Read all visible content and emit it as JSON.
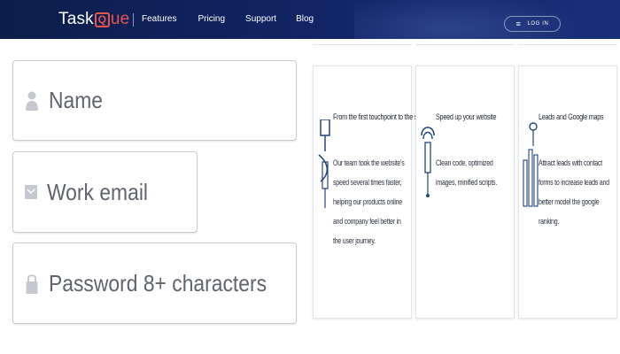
{
  "brand": {
    "logo_prefix": "Task",
    "logo_mark": "Q",
    "logo_suffix": "ue",
    "accent": "#e2564f"
  },
  "nav": {
    "items": [
      "Features",
      "Pricing",
      "Support",
      "Blog"
    ]
  },
  "header": {
    "login_label": "LOG IN",
    "login_icon": "login-icon",
    "background": "#13266a"
  },
  "form": {
    "name_placeholder": "Name",
    "email_placeholder": "Work email",
    "password_placeholder": "Password 8+ characters"
  },
  "cards": [
    {
      "icon": "building-icon",
      "title": "From the first touchpoint to the sale",
      "text": "Our team took the website's speed several times faster, helping our products online and company feel better in the user journey."
    },
    {
      "icon": "speed-icon",
      "title": "Speed up your website",
      "text": "Clean code, optimized images, minified scripts."
    },
    {
      "icon": "chart-icon",
      "title": "Leads and Google maps",
      "text": "Attract leads with contact forms to increase leads and better model the google ranking."
    }
  ]
}
